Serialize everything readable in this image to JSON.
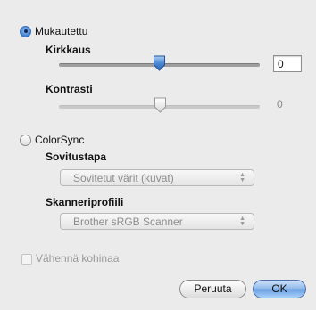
{
  "custom": {
    "label": "Mukautettu",
    "selected": true
  },
  "brightness": {
    "label": "Kirkkaus",
    "value": "0",
    "level": 0.5
  },
  "contrast": {
    "label": "Kontrasti",
    "value": "0",
    "level": 0.5
  },
  "colorsync": {
    "label": "ColorSync",
    "selected": false,
    "method_label": "Sovitustapa",
    "method_value": "Sovitetut värit (kuvat)",
    "profile_label": "Skanneriprofiili",
    "profile_value": "Brother sRGB Scanner"
  },
  "noise": {
    "label": "Vähennä kohinaa",
    "checked": false,
    "enabled": false
  },
  "buttons": {
    "cancel": "Peruuta",
    "ok": "OK"
  },
  "colors": {
    "accent": "#3d7cd0",
    "panel": "#ebebeb"
  }
}
